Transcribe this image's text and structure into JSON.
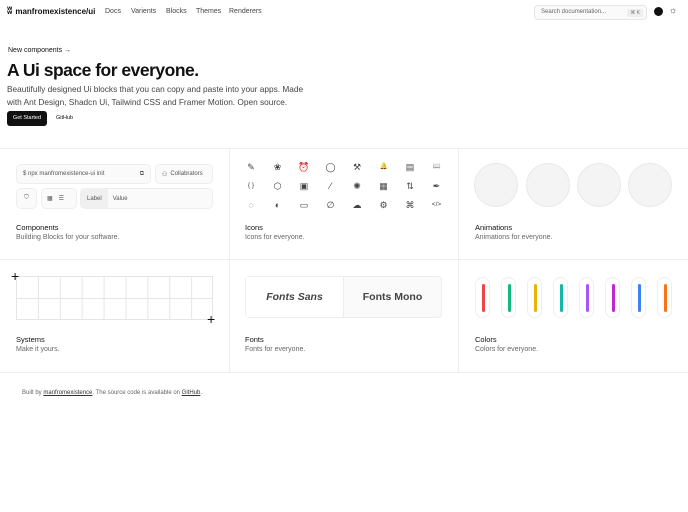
{
  "header": {
    "brand": "manfromexistence/ui",
    "nav": [
      "Docs",
      "Varients",
      "Blocks",
      "Themes",
      "Renderers"
    ],
    "search_placeholder": "Search documentation...",
    "search_shortcut": "⌘ K"
  },
  "hero": {
    "announcement": "New components →",
    "title": "A Ui space for everyone.",
    "description_line1": "Beautifully designed Ui blocks that you can copy and paste into your apps. Made",
    "description_line2": "with Ant Design, Shadcn Ui, Tailwind CSS and Framer Motion. Open source.",
    "primary_button": "Get Started",
    "secondary_button": "GitHub"
  },
  "components_preview": {
    "command": "$ npx manfromexistence-ui init",
    "collaborators": "Collabrators",
    "label": "Label",
    "value": "Value"
  },
  "icons_preview": [
    "✎",
    "❀",
    "⏰",
    "◯",
    "⚒",
    "🔔",
    "▤",
    "📖",
    "{ }",
    "⬡",
    "▣",
    "⁄",
    "✺",
    "▦",
    "⇅",
    "✒",
    "◌",
    "◐",
    "▭",
    "∅",
    "☁",
    "⚙",
    "⌘",
    "</>"
  ],
  "fonts_preview": {
    "sans": "Fonts Sans",
    "mono": "Fonts Mono"
  },
  "colors_preview": [
    "#ef4444",
    "#10b981",
    "#eab308",
    "#14b8a6",
    "#a855f7",
    "#c026d3",
    "#3b82f6",
    "#f97316"
  ],
  "cells": {
    "components": {
      "title": "Components",
      "subtitle": "Building Blocks for your software."
    },
    "icons": {
      "title": "Icons",
      "subtitle": "Icons for everyone."
    },
    "animations": {
      "title": "Animations",
      "subtitle": "Animations for everyone."
    },
    "systems": {
      "title": "Systems",
      "subtitle": "Make it yours."
    },
    "fonts": {
      "title": "Fonts",
      "subtitle": "Fonts for everyone."
    },
    "colors": {
      "title": "Colors",
      "subtitle": "Colors for everyone."
    }
  },
  "footer": {
    "prefix": "Built by",
    "author": "manfromexistence",
    "middle": ". The source code is available on",
    "link": "GitHub",
    "suffix": "."
  }
}
